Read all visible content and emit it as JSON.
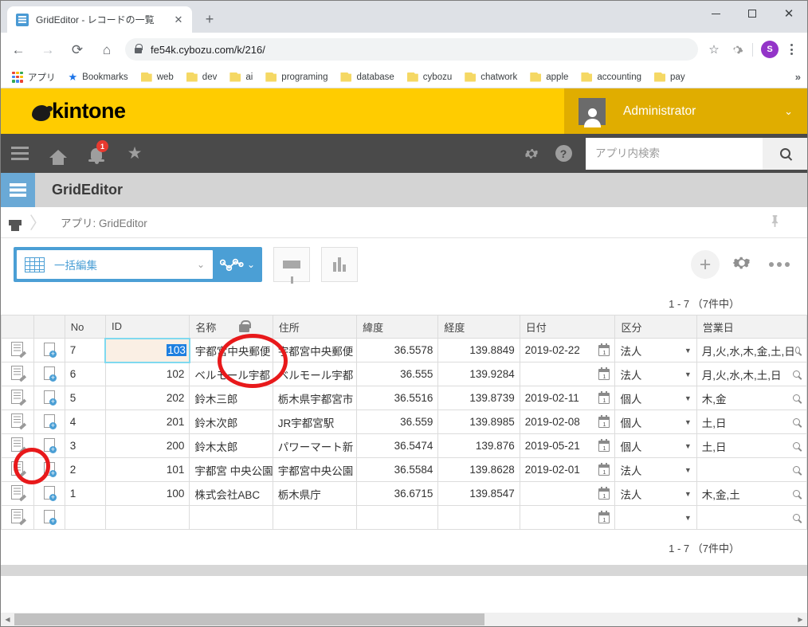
{
  "browser": {
    "tab": {
      "title": "GridEditor - レコードの一覧",
      "close_label": "✕",
      "favicon": "grid-favicon"
    },
    "newtab_label": "+",
    "window_controls": {
      "minimize": "—",
      "maximize": "□",
      "close": "✕"
    },
    "nav": {
      "back": "←",
      "forward": "→",
      "reload": "⟳",
      "home": "⌂"
    },
    "url": "fe54k.cybozu.com/k/216/",
    "omnibox_icons": {
      "bookmark_star": "☆",
      "extension": "gear-extension-icon",
      "profile_initial": "S",
      "menu": "kebab-menu-icon"
    },
    "bookmarks": [
      {
        "label": "アプリ",
        "icon": "apps-grid-icon"
      },
      {
        "label": "Bookmarks",
        "icon": "star-icon"
      },
      {
        "label": "web",
        "icon": "folder-icon"
      },
      {
        "label": "dev",
        "icon": "folder-icon"
      },
      {
        "label": "ai",
        "icon": "folder-icon"
      },
      {
        "label": "programing",
        "icon": "folder-icon"
      },
      {
        "label": "database",
        "icon": "folder-icon"
      },
      {
        "label": "cybozu",
        "icon": "folder-icon"
      },
      {
        "label": "chatwork",
        "icon": "folder-icon"
      },
      {
        "label": "apple",
        "icon": "folder-icon"
      },
      {
        "label": "accounting",
        "icon": "folder-icon"
      },
      {
        "label": "pay",
        "icon": "folder-icon"
      }
    ],
    "bookmarks_overflow": "»"
  },
  "kintone": {
    "brand": "kintone",
    "user": {
      "name": "Administrator",
      "chevron": "⌄"
    },
    "nav_badge": "1",
    "search": {
      "placeholder": "アプリ内検索",
      "value": ""
    },
    "app": {
      "name": "GridEditor"
    },
    "breadcrumb": {
      "home_icon": "home-icon",
      "text": "アプリ: GridEditor"
    }
  },
  "toolbar": {
    "bulk_edit_label": "一括編集",
    "bulk_chevron": "⌄",
    "graph_chevron": "⌄",
    "filter_icon": "funnel-icon",
    "chart_icon": "bar-chart-icon",
    "add_label": "+",
    "settings_icon": "gear-icon",
    "more_icon": "ellipsis-icon"
  },
  "pagination": {
    "top": "1 - 7 （7件中）",
    "bottom": "1 - 7 （7件中）"
  },
  "grid": {
    "columns": [
      {
        "key": "edit",
        "label": ""
      },
      {
        "key": "dup",
        "label": ""
      },
      {
        "key": "no",
        "label": "No"
      },
      {
        "key": "id",
        "label": "ID"
      },
      {
        "key": "name",
        "label": "名称",
        "locked": true
      },
      {
        "key": "addr",
        "label": "住所"
      },
      {
        "key": "lat",
        "label": "緯度"
      },
      {
        "key": "lng",
        "label": "経度"
      },
      {
        "key": "date",
        "label": "日付"
      },
      {
        "key": "type",
        "label": "区分"
      },
      {
        "key": "days",
        "label": "営業日"
      }
    ],
    "rows": [
      {
        "no": "7",
        "id": "103",
        "name": "宇都宮中央郵便",
        "addr": "宇都宮中央郵便",
        "lat": "36.5578",
        "lng": "139.8849",
        "date": "2019-02-22",
        "type": "法人",
        "days": "月,火,水,木,金,土,日",
        "editing": true
      },
      {
        "no": "6",
        "id": "102",
        "name": "ベルモール宇都",
        "addr": "ベルモール宇都",
        "lat": "36.555",
        "lng": "139.9284",
        "date": "",
        "type": "法人",
        "days": "月,火,水,木,土,日"
      },
      {
        "no": "5",
        "id": "202",
        "name": "鈴木三郎",
        "addr": "栃木県宇都宮市",
        "lat": "36.5516",
        "lng": "139.8739",
        "date": "2019-02-11",
        "type": "個人",
        "days": "木,金"
      },
      {
        "no": "4",
        "id": "201",
        "name": "鈴木次郎",
        "addr": "JR宇都宮駅",
        "lat": "36.559",
        "lng": "139.8985",
        "date": "2019-02-08",
        "type": "個人",
        "days": "土,日"
      },
      {
        "no": "3",
        "id": "200",
        "name": "鈴木太郎",
        "addr": "パワーマート新",
        "lat": "36.5474",
        "lng": "139.876",
        "date": "2019-05-21",
        "type": "個人",
        "days": "土,日"
      },
      {
        "no": "2",
        "id": "101",
        "name": "宇都宮 中央公園",
        "addr": "宇都宮中央公園",
        "lat": "36.5584",
        "lng": "139.8628",
        "date": "2019-02-01",
        "type": "法人",
        "days": ""
      },
      {
        "no": "1",
        "id": "100",
        "name": "株式会社ABC",
        "addr": "栃木県庁",
        "lat": "36.6715",
        "lng": "139.8547",
        "date": "",
        "type": "法人",
        "days": "木,金,土"
      },
      {
        "no": "",
        "id": "",
        "name": "",
        "addr": "",
        "lat": "",
        "lng": "",
        "date": "",
        "type": "",
        "days": ""
      }
    ],
    "row_icons": {
      "edit": "edit-record-icon",
      "duplicate": "duplicate-record-icon",
      "lookup": "lookup-search-icon"
    },
    "selection_text": "103"
  },
  "colors": {
    "kintone_yellow": "#ffcc00",
    "kintone_user_bar": "#e0ad00",
    "nav_dark": "#4a4a4a",
    "accent_blue": "#4b9fd5",
    "annotation_red": "#e8191b",
    "selected_text_bg": "#1d7fe0",
    "editing_cell_bg": "#faefe4"
  }
}
